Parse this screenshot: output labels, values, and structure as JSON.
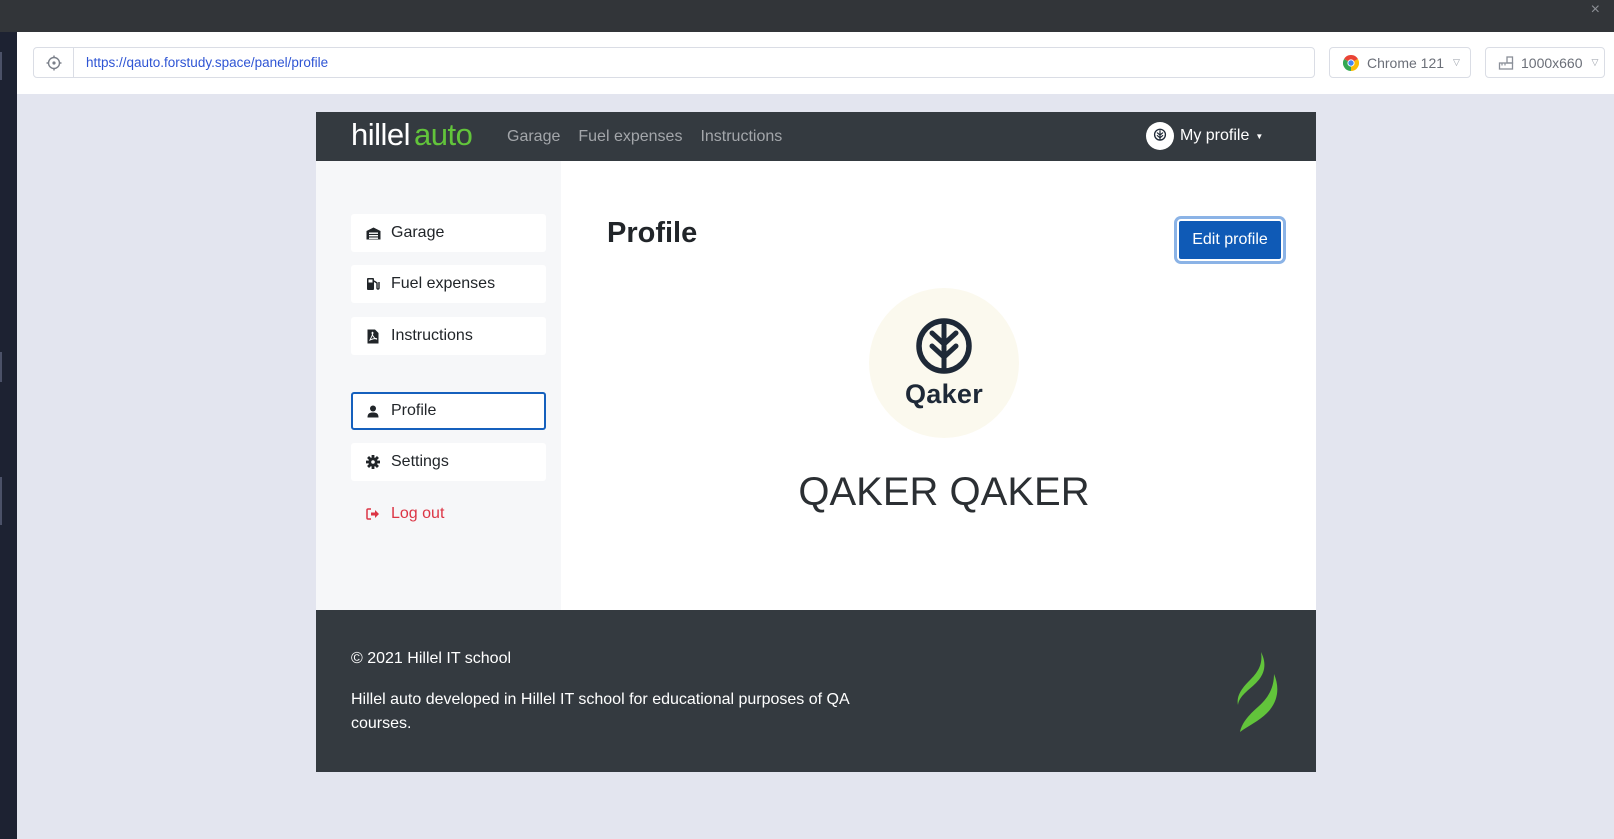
{
  "browser": {
    "url": "https://qauto.forstudy.space/panel/profile",
    "browser_label": "Chrome 121",
    "viewport_label": "1000x660",
    "close_glyph": "×"
  },
  "navbar": {
    "logo_part1": "hillel",
    "logo_part2": "auto",
    "links": [
      "Garage",
      "Fuel expenses",
      "Instructions"
    ],
    "profile_menu": "My profile"
  },
  "sidebar": {
    "items": [
      {
        "label": "Garage",
        "icon": "garage-icon"
      },
      {
        "label": "Fuel expenses",
        "icon": "fuel-pump-icon"
      },
      {
        "label": "Instructions",
        "icon": "pdf-file-icon"
      },
      {
        "label": "Profile",
        "icon": "user-icon"
      },
      {
        "label": "Settings",
        "icon": "gear-icon"
      },
      {
        "label": "Log out",
        "icon": "logout-icon"
      }
    ],
    "active": "Profile"
  },
  "main": {
    "title": "Profile",
    "edit_button": "Edit profile",
    "avatar_brand": "Qaker",
    "user_name": "QAKER QAKER"
  },
  "footer": {
    "copyright": "© 2021 Hillel IT school",
    "description": "Hillel auto developed in Hillel IT school for educational purposes of QA courses."
  },
  "colors": {
    "navbar_bg": "#343a40",
    "brand_green": "#62c43b",
    "primary": "#0f5ab6",
    "danger": "#dc3545"
  }
}
